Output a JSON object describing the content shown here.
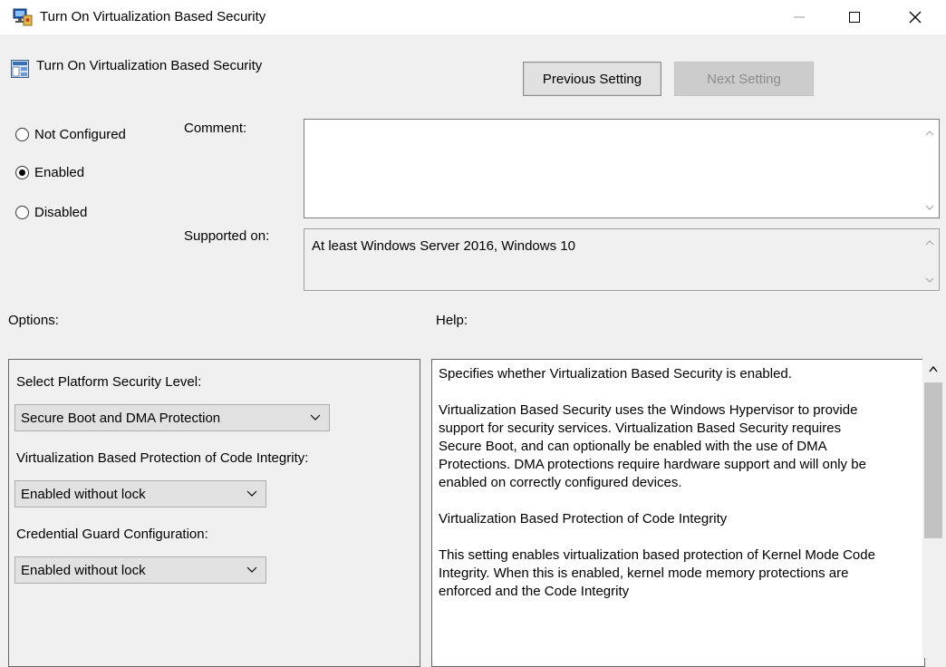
{
  "window": {
    "title": "Turn On Virtualization Based Security",
    "minimize_glyph": "—",
    "maximize_glyph": "☐",
    "close_glyph": "✕"
  },
  "header": {
    "setting_title": "Turn On Virtualization Based Security",
    "previous_label": "Previous Setting",
    "next_label": "Next Setting"
  },
  "state": {
    "options": [
      {
        "label": "Not Configured",
        "checked": false
      },
      {
        "label": "Enabled",
        "checked": true
      },
      {
        "label": "Disabled",
        "checked": false
      }
    ]
  },
  "comment": {
    "label": "Comment:",
    "value": ""
  },
  "supported": {
    "label": "Supported on:",
    "value": "At least Windows Server 2016, Windows 10"
  },
  "options_panel": {
    "label": "Options:",
    "platform_label": "Select Platform Security Level:",
    "platform_value": "Secure Boot and DMA Protection",
    "code_integrity_label": "Virtualization Based Protection of Code Integrity:",
    "code_integrity_value": "Enabled without lock",
    "credential_guard_label": "Credential Guard Configuration:",
    "credential_guard_value": "Enabled without lock"
  },
  "help_panel": {
    "label": "Help:",
    "paragraphs": [
      "Specifies whether Virtualization Based Security is enabled.",
      "Virtualization Based Security uses the Windows Hypervisor to provide support for security services. Virtualization Based Security requires Secure Boot, and can optionally be enabled with the use of DMA Protections. DMA protections require hardware support and will only be enabled on correctly configured devices.",
      "Virtualization Based Protection of Code Integrity",
      "This setting enables virtualization based protection of Kernel Mode Code Integrity. When this is enabled, kernel mode memory protections are enforced and the Code Integrity"
    ]
  },
  "colors": {
    "window_bg": "#f0f0f0",
    "button_bg": "#e1e1e1",
    "disabled_text": "#8c8c8c"
  }
}
